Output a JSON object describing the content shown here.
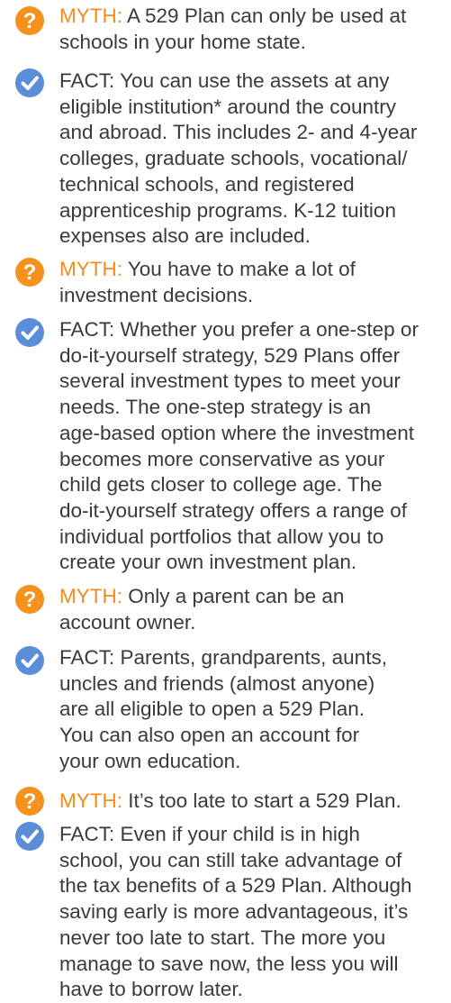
{
  "colors": {
    "myth_icon": "#f5921e",
    "fact_icon": "#5b8ed8",
    "myth_label": "#f48c1b",
    "text": "#3a3a3a"
  },
  "icons": {
    "myth": "question-mark-circle-icon",
    "fact": "checkmark-circle-icon"
  },
  "entries": [
    {
      "label": "MYTH:",
      "lines": [
        " A 529 Plan can only be used at",
        "schools in your home state."
      ]
    },
    {
      "label": "FACT:",
      "lines": [
        " You can use the assets at any",
        "eligible institution* around the country",
        "and abroad. This includes 2- and 4-year",
        "colleges, graduate schools, vocational/",
        "technical schools, and registered",
        "apprenticeship programs. K-12 tuition",
        "expenses also are included."
      ]
    },
    {
      "label": "MYTH:",
      "lines": [
        " You have to make a lot of",
        "investment decisions."
      ]
    },
    {
      "label": "FACT:",
      "lines": [
        " Whether you prefer a one-step or",
        "do-it-yourself strategy, 529 Plans offer",
        "several investment types to meet your",
        "needs. The one-step strategy is an",
        "age-based option where the investment",
        "becomes more conservative as your",
        "child gets closer to college age. The",
        "do-it-yourself strategy offers a range of",
        "individual portfolios that allow you to",
        "create your own investment plan."
      ]
    },
    {
      "label": "MYTH:",
      "lines": [
        " Only a parent can be an",
        "account owner."
      ]
    },
    {
      "label": "FACT:",
      "lines": [
        " Parents, grandparents, aunts,",
        "uncles and friends (almost anyone)",
        "are all eligible to open a 529 Plan.",
        "You can also open an account for",
        "your own education."
      ]
    },
    {
      "label": "MYTH:",
      "lines": [
        " It’s too late to start a 529 Plan."
      ]
    },
    {
      "label": "FACT:",
      "lines": [
        " Even if your child is in high",
        "school, you can still take advantage of",
        "the tax benefits of a 529 Plan. Although",
        "saving early is more advantageous, it’s",
        "never too late to start. The more you",
        "manage to save now, the less you will",
        "have to borrow later."
      ]
    }
  ]
}
